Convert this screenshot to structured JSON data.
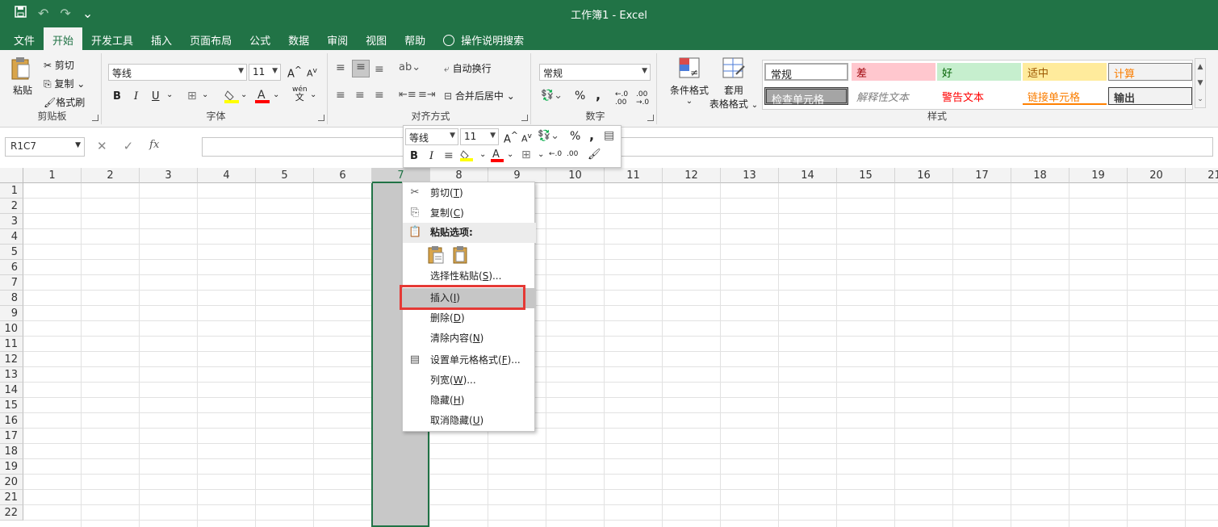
{
  "title": "工作簿1  -  Excel",
  "quick_access": {
    "save": "save-icon",
    "undo": "↶",
    "redo": "↷",
    "customize": "⌄"
  },
  "menu": [
    "文件",
    "开始",
    "开发工具",
    "插入",
    "页面布局",
    "公式",
    "数据",
    "审阅",
    "视图",
    "帮助"
  ],
  "menu_active": "开始",
  "search_label": "操作说明搜索",
  "clipboard": {
    "paste": "粘贴",
    "cut": "剪切",
    "copy": "复制",
    "format_painter": "格式刷",
    "group": "剪贴板"
  },
  "font": {
    "name": "等线",
    "size": "11",
    "bold": "B",
    "italic": "I",
    "underline": "U",
    "group": "字体",
    "phonetic_top": "wén",
    "phonetic_bottom": "文"
  },
  "alignment": {
    "wrap": "自动换行",
    "merge": "合并后居中",
    "group": "对齐方式"
  },
  "number": {
    "format": "常规",
    "percent": "%",
    "comma": ",",
    "group": "数字"
  },
  "styles": {
    "conditional": "条件格式",
    "table_format_1": "套用",
    "table_format_2": "表格格式",
    "cells": [
      "常规",
      "差",
      "好",
      "适中",
      "计算",
      "检查单元格",
      "解释性文本",
      "警告文本",
      "链接单元格",
      "输出"
    ],
    "group": "样式"
  },
  "formula_bar": {
    "name_box": "R1C7",
    "cancel": "✕",
    "enter": "✓",
    "fx": "fx",
    "value": ""
  },
  "columns": [
    "1",
    "2",
    "3",
    "4",
    "5",
    "6",
    "7",
    "8",
    "9",
    "10",
    "11",
    "12",
    "13",
    "14",
    "15",
    "16",
    "17",
    "18",
    "19",
    "20",
    "21"
  ],
  "rows": [
    "1",
    "2",
    "3",
    "4",
    "5",
    "6",
    "7",
    "8",
    "9",
    "10",
    "11",
    "12",
    "13",
    "14",
    "15",
    "16",
    "17",
    "18",
    "19",
    "20",
    "21",
    "22"
  ],
  "selected_column": "7",
  "mini_toolbar": {
    "font": "等线",
    "size": "11",
    "bold": "B",
    "italic": "I",
    "percent": "%",
    "comma": ","
  },
  "context_menu": [
    {
      "label": "剪切(",
      "key": "T",
      "end": ")",
      "icon": "✂"
    },
    {
      "label": "复制(",
      "key": "C",
      "end": ")",
      "icon": "⎘"
    },
    {
      "label": "粘贴选项:",
      "key": "",
      "end": "",
      "icon": "📋"
    },
    {
      "label": "选择性粘贴(",
      "key": "S",
      "end": ")...",
      "icon": ""
    },
    {
      "label": "插入(",
      "key": "I",
      "end": ")",
      "icon": ""
    },
    {
      "label": "删除(",
      "key": "D",
      "end": ")",
      "icon": ""
    },
    {
      "label": "清除内容(",
      "key": "N",
      "end": ")",
      "icon": ""
    },
    {
      "label": "设置单元格格式(",
      "key": "F",
      "end": ")...",
      "icon": "▤"
    },
    {
      "label": "列宽(",
      "key": "W",
      "end": ")...",
      "icon": ""
    },
    {
      "label": "隐藏(",
      "key": "H",
      "end": ")",
      "icon": ""
    },
    {
      "label": "取消隐藏(",
      "key": "U",
      "end": ")",
      "icon": ""
    }
  ],
  "colors": {
    "excel_green": "#217346",
    "highlight_red": "#e53935"
  }
}
